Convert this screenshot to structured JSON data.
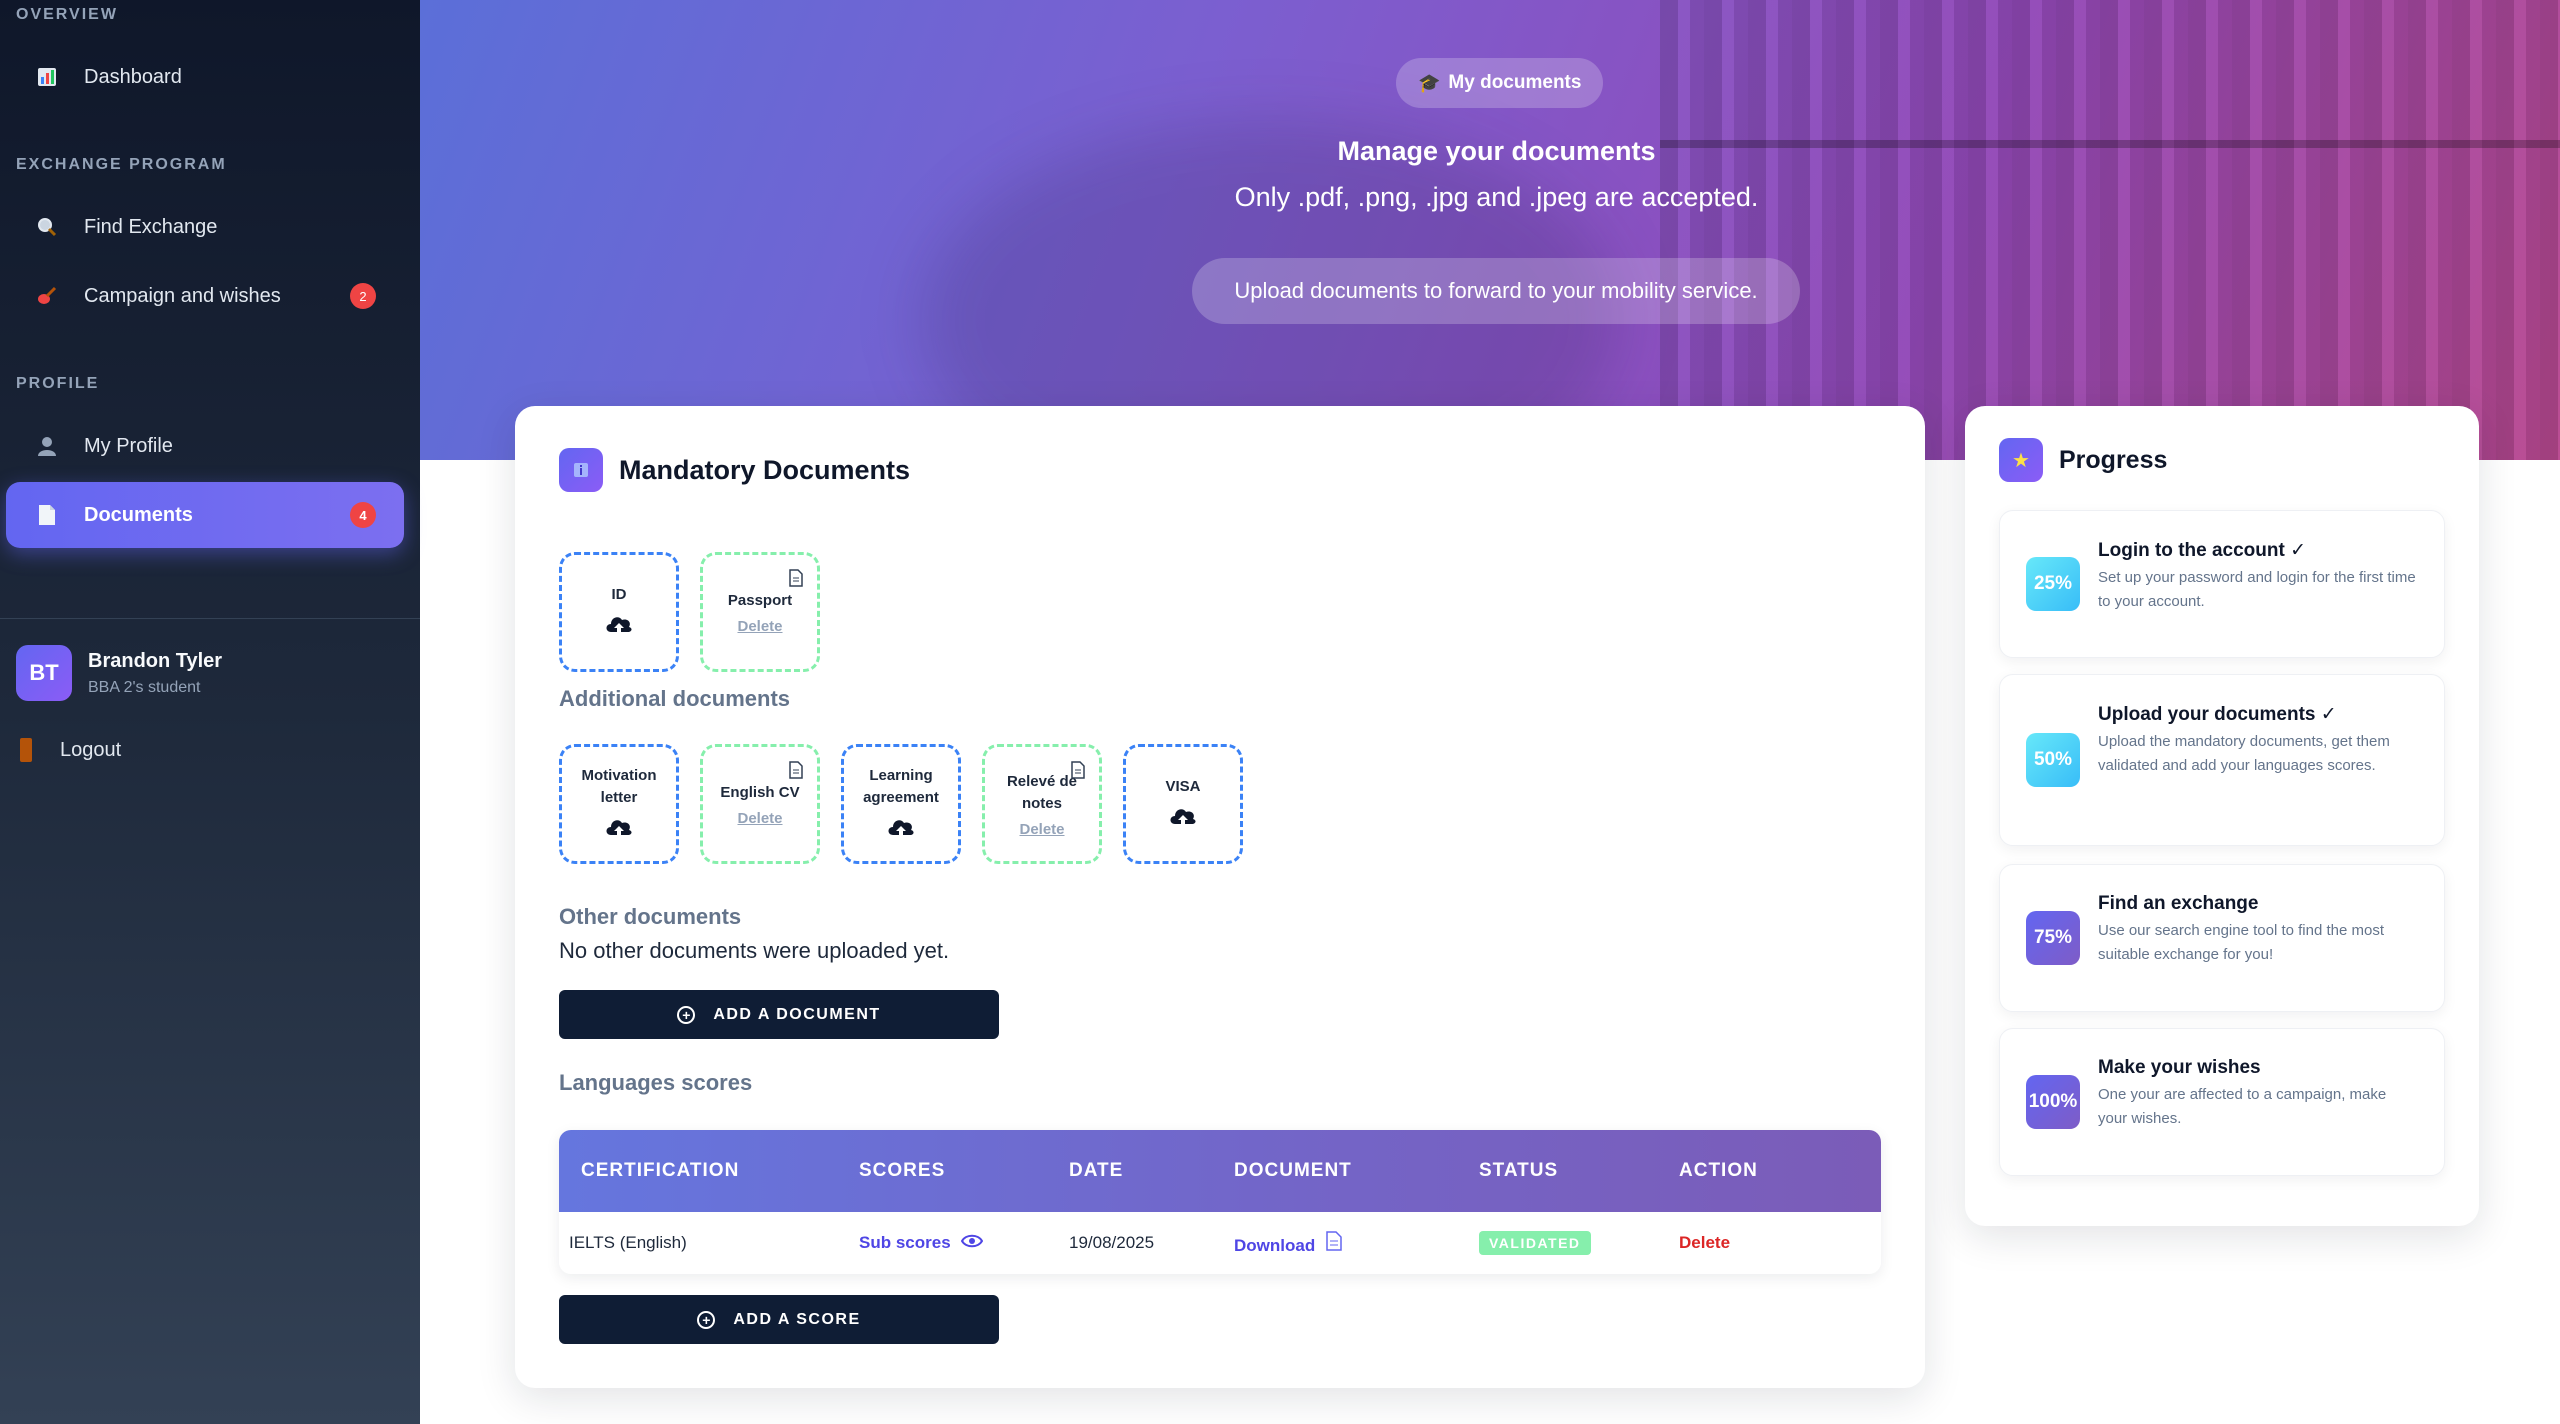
{
  "sidebar": {
    "sections": {
      "overview": "OVERVIEW",
      "exchange": "EXCHANGE PROGRAM",
      "profile": "PROFILE"
    },
    "items": {
      "dashboard": {
        "label": "Dashboard",
        "icon": "bar-chart-icon"
      },
      "find_exchange": {
        "label": "Find Exchange",
        "icon": "magnifier-icon"
      },
      "campaign": {
        "label": "Campaign and wishes",
        "icon": "guitar-icon",
        "badge": "2"
      },
      "my_profile": {
        "label": "My Profile",
        "icon": "person-icon"
      },
      "documents": {
        "label": "Documents",
        "icon": "document-icon",
        "badge": "4"
      }
    },
    "user": {
      "initials": "BT",
      "name": "Brandon Tyler",
      "role": "BBA 2's student"
    },
    "logout": "Logout"
  },
  "hero": {
    "chip": "My documents",
    "title": "Manage your documents",
    "subtitle": "Only .pdf, .png, .jpg and .jpeg are accepted.",
    "cta": "Upload documents to forward to your mobility service."
  },
  "mandatory": {
    "title": "Mandatory Documents",
    "tiles": [
      {
        "label": "ID",
        "state": "empty"
      },
      {
        "label": "Passport",
        "state": "uploaded",
        "delete": "Delete"
      }
    ]
  },
  "additional": {
    "title": "Additional documents",
    "tiles": [
      {
        "label": "Motivation letter",
        "state": "empty"
      },
      {
        "label": "English CV",
        "state": "uploaded",
        "delete": "Delete"
      },
      {
        "label": "Learning agreement",
        "state": "empty"
      },
      {
        "label": "Relevé de notes",
        "state": "uploaded",
        "delete": "Delete"
      },
      {
        "label": "VISA",
        "state": "empty"
      }
    ]
  },
  "other": {
    "title": "Other documents",
    "empty_text": "No other documents were uploaded yet.",
    "add_button": "ADD A DOCUMENT"
  },
  "languages": {
    "title": "Languages scores",
    "columns": [
      "CERTIFICATION",
      "SCORES",
      "DATE",
      "DOCUMENT",
      "STATUS",
      "ACTION"
    ],
    "rows": [
      {
        "certification": "IELTS (English)",
        "scores": "Sub scores",
        "date": "19/08/2025",
        "document": "Download",
        "status": "VALIDATED",
        "action": "Delete"
      }
    ],
    "add_button": "ADD A SCORE"
  },
  "progress": {
    "title": "Progress",
    "steps": [
      {
        "percent": "25%",
        "title": "Login to the account",
        "done": true,
        "description": "Set up your password and login for the first time to your account."
      },
      {
        "percent": "50%",
        "title": "Upload your documents",
        "done": true,
        "description": "Upload the mandatory documents, get them validated and add your languages scores."
      },
      {
        "percent": "75%",
        "title": "Find an exchange",
        "done": false,
        "description": "Use our search engine tool to find the most suitable exchange for you!"
      },
      {
        "percent": "100%",
        "title": "Make your wishes",
        "done": false,
        "description": "One your are affected to a campaign, make your wishes."
      }
    ]
  },
  "colors": {
    "accent": "#6366f1",
    "sidebar_bg": "#0f172a",
    "uploaded_border": "#86efac",
    "empty_border": "#3b82f6",
    "danger": "#dc2626"
  }
}
